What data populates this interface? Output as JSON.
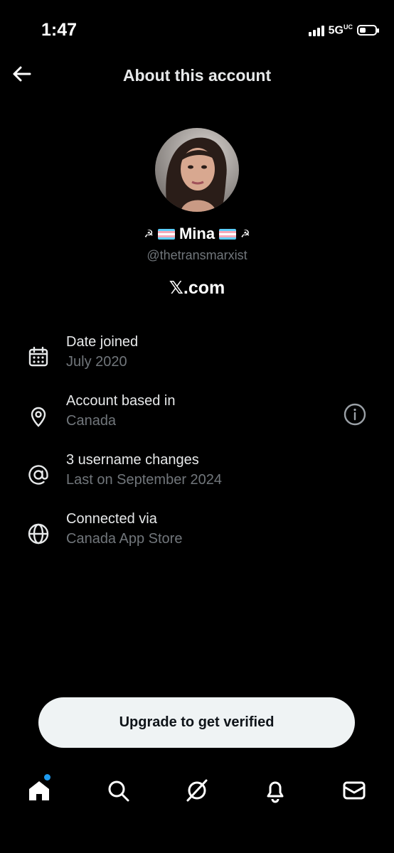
{
  "status_bar": {
    "time": "1:47",
    "network": "5G",
    "network_sup": "UC"
  },
  "header": {
    "title": "About this account"
  },
  "profile": {
    "name": "Mina",
    "left_symbol": "☭",
    "right_symbol": "☭",
    "handle": "@thetransmarxist",
    "platform": "𝕏.com"
  },
  "rows": [
    {
      "label": "Date joined",
      "value": "July 2020",
      "icon": "calendar-icon"
    },
    {
      "label": "Account based in",
      "value": "Canada",
      "icon": "location-pin-icon"
    },
    {
      "label": "3 username changes",
      "value": "Last on September 2024",
      "icon": "at-sign-icon"
    },
    {
      "label": "Connected via",
      "value": "Canada App Store",
      "icon": "globe-icon"
    }
  ],
  "upgrade_button": {
    "label": "Upgrade to get verified"
  },
  "tab_bar": {
    "items": [
      "home-icon",
      "search-icon",
      "grok-icon",
      "notifications-icon",
      "messages-icon"
    ],
    "notification_dot_color": "#1d9bf0"
  }
}
